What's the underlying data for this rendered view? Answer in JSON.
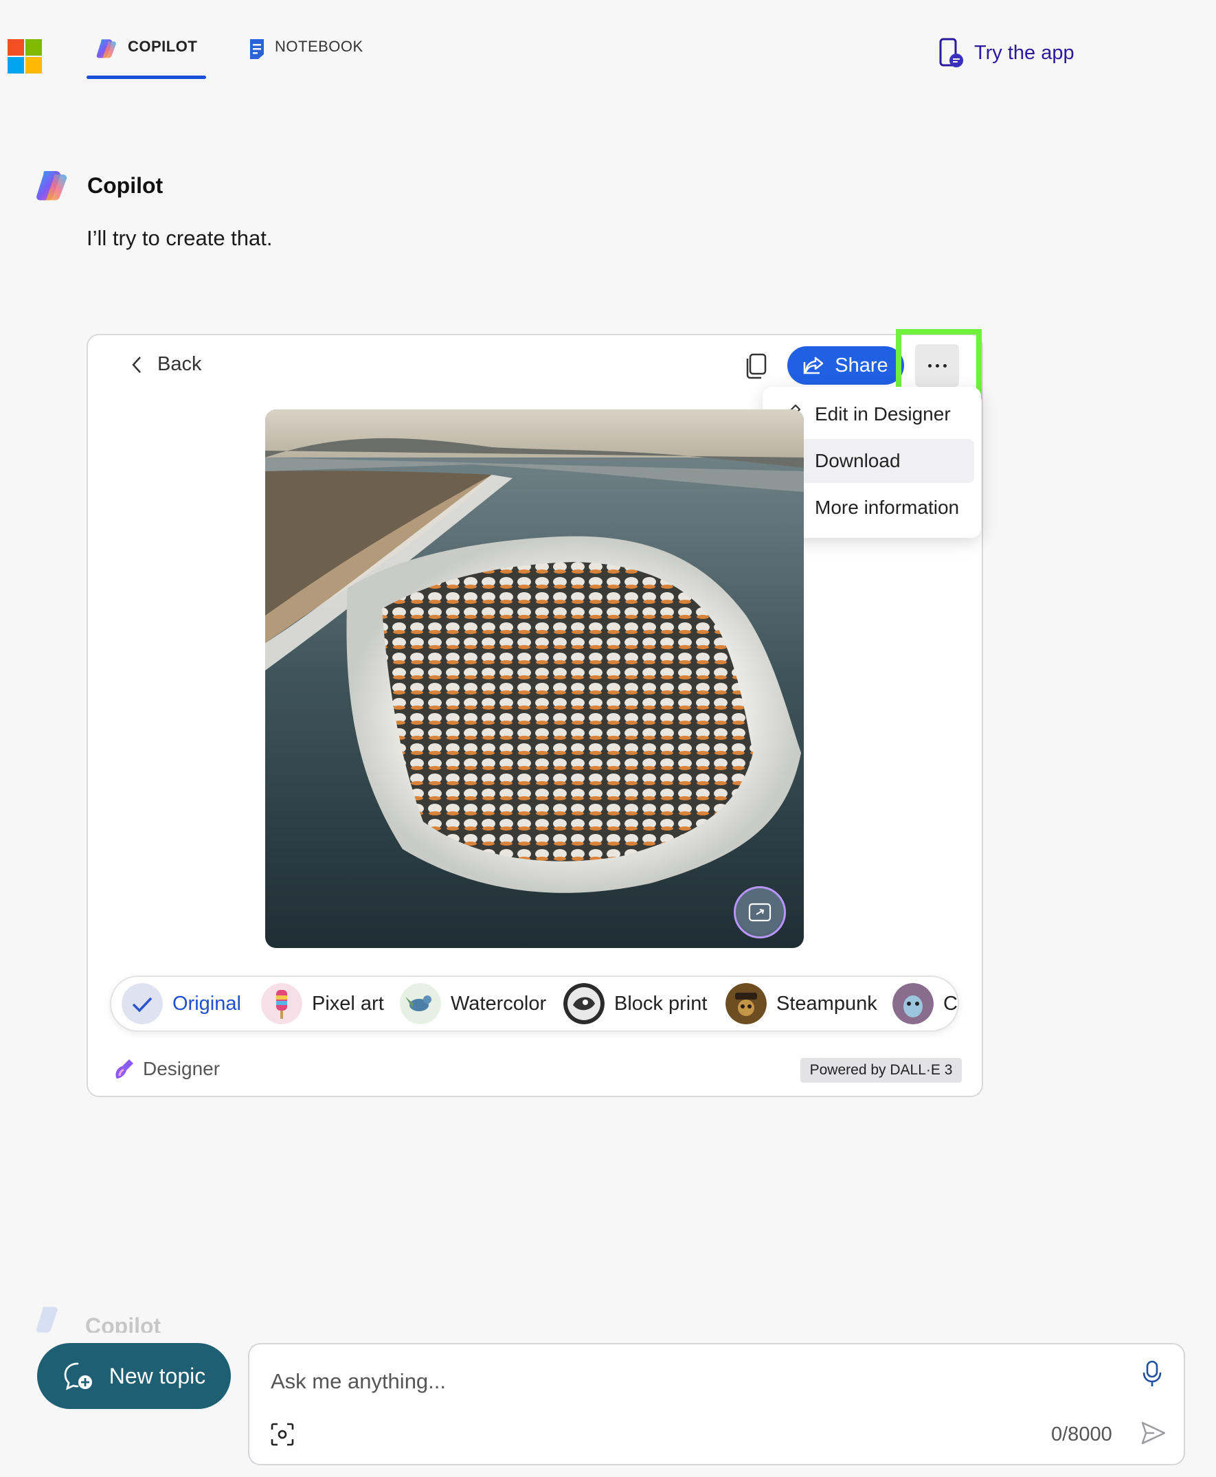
{
  "header": {
    "logo_icon": "microsoft-logo-icon",
    "tabs": [
      {
        "label": "COPILOT",
        "icon": "copilot-icon",
        "active": true
      },
      {
        "label": "NOTEBOOK",
        "icon": "notebook-icon",
        "active": false
      }
    ],
    "try_app_label": "Try the app"
  },
  "message": {
    "sender": "Copilot",
    "text": "I’ll try to create that."
  },
  "image_card": {
    "back_label": "Back",
    "share_label": "Share",
    "more_menu": [
      {
        "label": "Edit in Designer",
        "icon": "pencil-icon"
      },
      {
        "label": "Download",
        "icon": "download-arrow-icon",
        "hovered": true
      },
      {
        "label": "More information",
        "icon": "info-icon"
      }
    ],
    "styles": [
      {
        "label": "Original",
        "selected": true
      },
      {
        "label": "Pixel art",
        "selected": false
      },
      {
        "label": "Watercolor",
        "selected": false
      },
      {
        "label": "Block print",
        "selected": false
      },
      {
        "label": "Steampunk",
        "selected": false
      },
      {
        "label": "Cla",
        "selected": false
      }
    ],
    "designer_label": "Designer",
    "powered_by": "Powered by DALL·E 3"
  },
  "peek": {
    "sender": "Copilot"
  },
  "composer": {
    "new_topic_label": "New topic",
    "placeholder": "Ask me anything...",
    "char_count": "0/8000"
  },
  "colors": {
    "accent_blue": "#2060e4",
    "tab_underline": "#1a50d8",
    "new_topic_bg": "#1f5f74",
    "highlight_green": "#6ff13d",
    "try_app_text": "#2b1a9e"
  }
}
